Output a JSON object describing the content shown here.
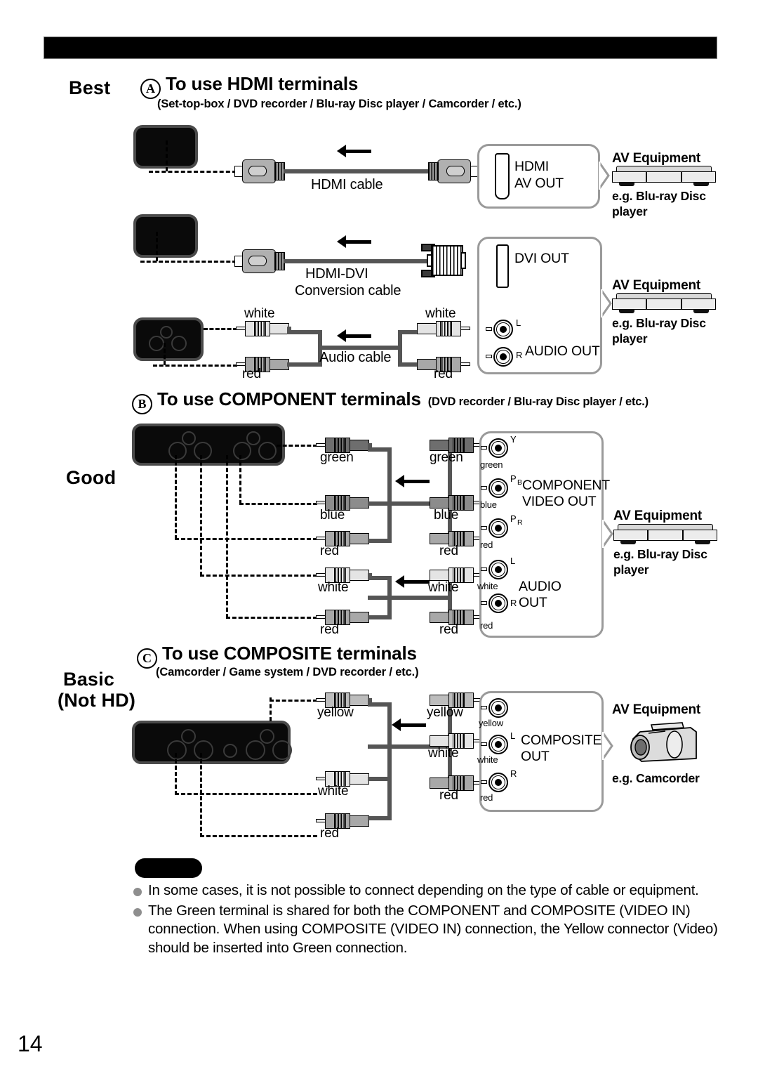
{
  "page": {
    "number": "14"
  },
  "grades": {
    "best": "Best",
    "good": "Good",
    "basic_line1": "Basic",
    "basic_line2": "(Not HD)"
  },
  "sections": [
    {
      "marker": "A",
      "title": "To use HDMI terminals",
      "subtitle": "(Set-top-box / DVD recorder / Blu-ray Disc player / Camcorder / etc.)"
    },
    {
      "marker": "B",
      "title": "To use COMPONENT terminals",
      "subtitle": "(DVD recorder / Blu-ray Disc player / etc.)"
    },
    {
      "marker": "C",
      "title": "To use COMPOSITE terminals",
      "subtitle": "(Camcorder / Game system / DVD recorder / etc.)"
    }
  ],
  "hdmi": {
    "cable_label": "HDMI cable",
    "dvi_cable_label_line1": "HDMI-DVI",
    "dvi_cable_label_line2": "Conversion cable",
    "audio_cable_label": "Audio cable",
    "audio_plugs_left": [
      "white",
      "red"
    ],
    "audio_plugs_right": [
      "white",
      "red"
    ],
    "box1": {
      "port_label_line1": "HDMI",
      "port_label_line2": "AV OUT"
    },
    "box2": {
      "dvi_label": "DVI OUT",
      "audio_label": "AUDIO OUT",
      "audio_ch_l": "L",
      "audio_ch_r": "R"
    }
  },
  "component": {
    "video_plugs_left": [
      "green",
      "blue",
      "red"
    ],
    "video_plugs_right": [
      "green",
      "blue",
      "red"
    ],
    "audio_plugs_left": [
      "white",
      "red"
    ],
    "audio_plugs_right": [
      "white",
      "red"
    ],
    "box": {
      "video_label_line1": "COMPONENT",
      "video_label_line2": "VIDEO OUT",
      "audio_label_line1": "AUDIO",
      "audio_label_line2": "OUT",
      "jacks": [
        {
          "mark": "Y",
          "sub": "",
          "color": "green"
        },
        {
          "mark": "P",
          "sub": "B",
          "color": "blue"
        },
        {
          "mark": "P",
          "sub": "R",
          "color": "red"
        },
        {
          "mark": "L",
          "sub": "",
          "color": "white"
        },
        {
          "mark": "R",
          "sub": "",
          "color": "red"
        }
      ]
    }
  },
  "composite": {
    "plugs_left": [
      "yellow",
      "white",
      "red"
    ],
    "plugs_right": [
      "yellow",
      "white",
      "red"
    ],
    "box": {
      "label_line1": "COMPOSITE",
      "label_line2": "OUT",
      "jacks": [
        {
          "mark": "",
          "color": "yellow"
        },
        {
          "mark": "L",
          "color": "white"
        },
        {
          "mark": "R",
          "color": "red"
        }
      ]
    }
  },
  "av_equipment": [
    {
      "title": "AV Equipment",
      "eg_line1": "e.g. Blu-ray Disc",
      "eg_line2": "player",
      "device": "deck"
    },
    {
      "title": "AV Equipment",
      "eg_line1": "e.g. Blu-ray Disc",
      "eg_line2": "player",
      "device": "deck"
    },
    {
      "title": "AV Equipment",
      "eg_line1": "e.g. Blu-ray Disc",
      "eg_line2": "player",
      "device": "deck"
    },
    {
      "title": "AV Equipment",
      "eg_line1": "e.g. Camcorder",
      "eg_line2": "",
      "device": "camcorder"
    }
  ],
  "notes": [
    "In some cases, it is not possible to connect depending on the type of cable or equipment.",
    "The Green terminal is shared for both the COMPONENT and COMPOSITE (VIDEO IN) connection. When using COMPOSITE (VIDEO IN) connection, the Yellow connector (Video) should be inserted into Green connection."
  ]
}
